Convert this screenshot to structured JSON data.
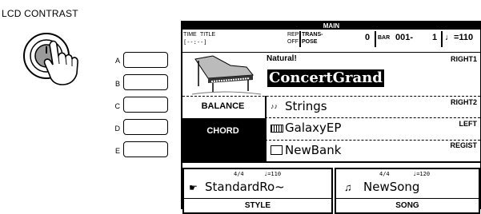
{
  "header": {
    "lcd_contrast_label": "LCD CONTRAST"
  },
  "side_buttons": [
    {
      "label": "A"
    },
    {
      "label": "B"
    },
    {
      "label": "C"
    },
    {
      "label": "D"
    },
    {
      "label": "E"
    }
  ],
  "screen": {
    "title": "MAIN",
    "time_label": "TIME",
    "time_value": "[--:--]",
    "title_label": "TITLE",
    "rep_label": "REP",
    "off_label": "OFF",
    "transpose_label_1": "TRANS-",
    "transpose_label_2": "POSE",
    "transpose_value": "0",
    "bar_label": "BAR",
    "bar_value": "001-",
    "beat_value": "1",
    "tempo_value": "♩=110"
  },
  "voice_area": {
    "natural_label": "Natural!",
    "main_voice": "ConcertGrand",
    "right1_label": "RIGHT1",
    "balance_label": "BALANCE",
    "chord_label": "CHORD",
    "right2_label": "RIGHT2",
    "right2_voice": "Strings",
    "left_label": "LEFT",
    "left_voice": "GalaxyEP",
    "regist_label": "REGIST",
    "regist_name": "NewBank"
  },
  "style_panel": {
    "time_sig": "4/4",
    "tempo": "♩=110",
    "name": "StandardRo~",
    "label": "STYLE"
  },
  "song_panel": {
    "time_sig": "4/4",
    "tempo": "♩=120",
    "name": "NewSong",
    "label": "SONG"
  },
  "colors": {
    "lcd_ink": "#000000",
    "lcd_bg": "#ffffff"
  }
}
